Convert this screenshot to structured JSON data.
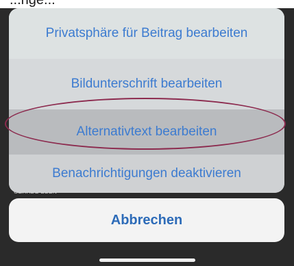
{
  "top_fragment": "...nge...",
  "underlay": {
    "timestamp_label": "GERADE EBEN"
  },
  "action_sheet": {
    "items": [
      {
        "label": "Privatsphäre für Beitrag bearbeiten"
      },
      {
        "label": "Bildunterschrift bearbeiten"
      },
      {
        "label": "Alternativtext bearbeiten",
        "highlighted": true
      },
      {
        "label": "Benachrichtigungen deaktivieren"
      }
    ],
    "cancel_label": "Abbrechen"
  },
  "colors": {
    "action_text": "#3c7bd0",
    "cancel_text": "#2d6bb8",
    "highlight_ring": "#8c2a4e",
    "sheet_background": "#cfd2d6",
    "backdrop": "#2a2a2a"
  }
}
